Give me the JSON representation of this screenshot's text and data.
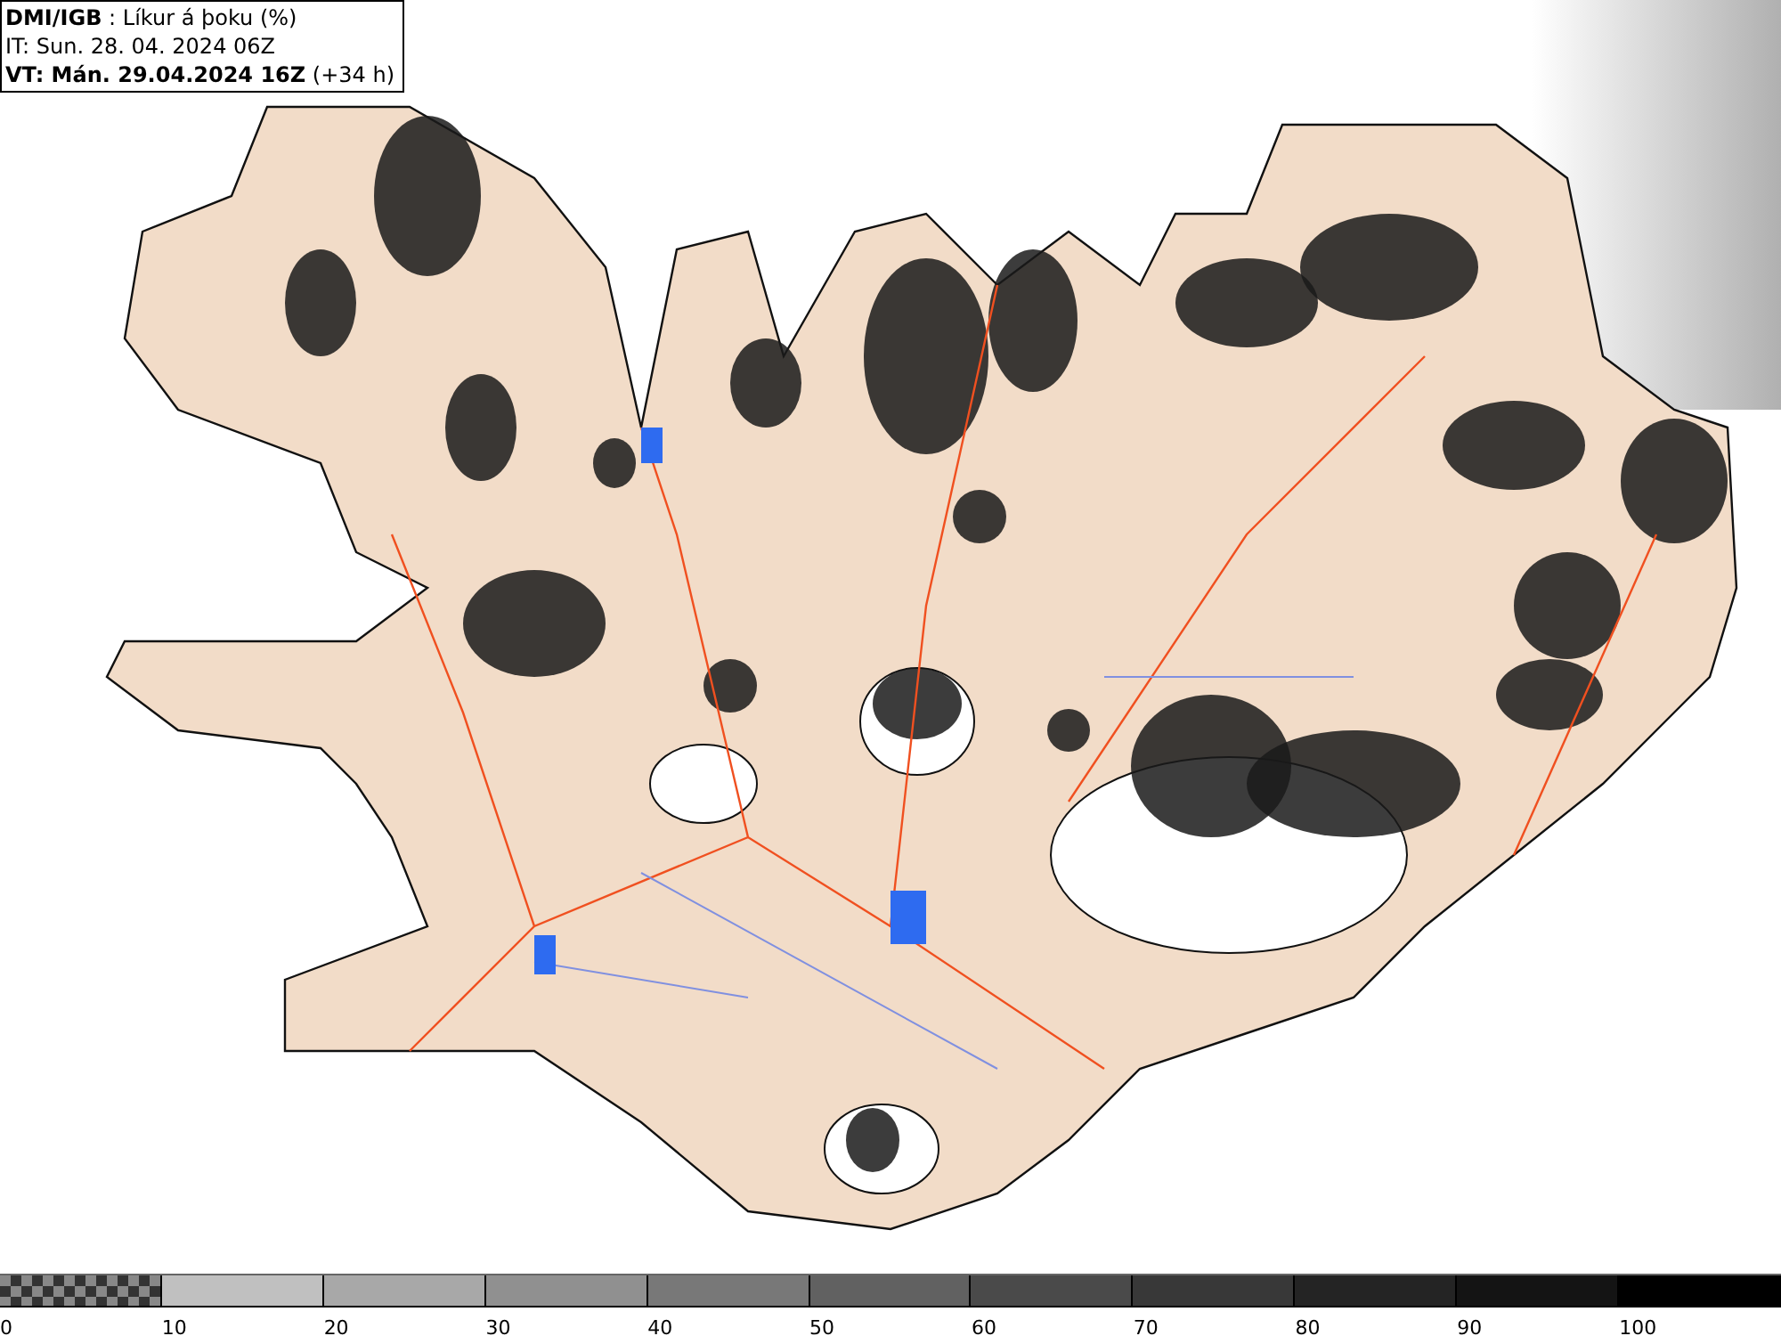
{
  "header": {
    "lines": [
      "**DMI/IGB** : Líkur á þoku (%)",
      "IT: Sun. 28. 04. 2024 06Z",
      "**VT: Mán. 29.04.2024 16Z** (+34 h)"
    ]
  },
  "legend": {
    "segments": [
      {
        "kind": "pattern",
        "color": "#333333"
      },
      {
        "kind": "solid",
        "color": "#c0c0c0"
      },
      {
        "kind": "solid",
        "color": "#a8a8a8"
      },
      {
        "kind": "solid",
        "color": "#909090"
      },
      {
        "kind": "solid",
        "color": "#787878"
      },
      {
        "kind": "solid",
        "color": "#616161"
      },
      {
        "kind": "solid",
        "color": "#4a4a4a"
      },
      {
        "kind": "solid",
        "color": "#383838"
      },
      {
        "kind": "solid",
        "color": "#242424"
      },
      {
        "kind": "solid",
        "color": "#141414"
      },
      {
        "kind": "solid",
        "color": "#000000"
      }
    ],
    "labels": [
      "0",
      "10",
      "20",
      "30",
      "40",
      "50",
      "60",
      "70",
      "80",
      "90",
      "100"
    ]
  }
}
